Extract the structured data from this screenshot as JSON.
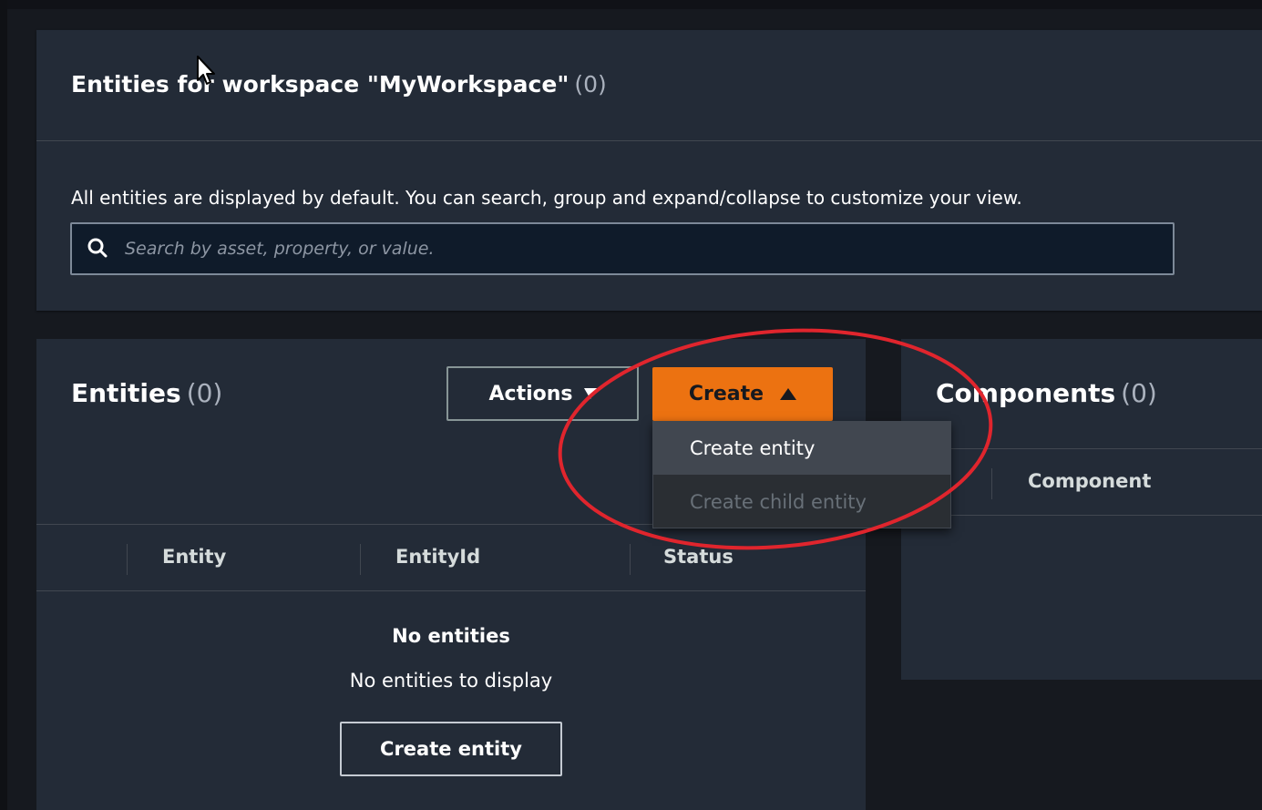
{
  "workspace_panel": {
    "title": "Entities for workspace \"MyWorkspace\"",
    "count": "(0)",
    "description": "All entities are displayed by default. You can search, group and expand/collapse to customize your view.",
    "search_placeholder": "Search by asset, property, or value."
  },
  "entities_panel": {
    "title": "Entities",
    "count": "(0)",
    "actions_label": "Actions",
    "create_label": "Create",
    "columns": [
      "Entity",
      "EntityId",
      "Status"
    ],
    "empty_title": "No entities",
    "empty_message": "No entities to display",
    "empty_create_label": "Create entity"
  },
  "create_menu": {
    "items": [
      {
        "label": "Create entity",
        "state": "highlighted"
      },
      {
        "label": "Create child entity",
        "state": "disabled"
      }
    ]
  },
  "components_panel": {
    "title": "Components",
    "count": "(0)",
    "columns": [
      "Component"
    ]
  },
  "colors": {
    "background": "#16191f",
    "panel": "#232b37",
    "primary_button": "#ec7211",
    "annotation": "#e0252d"
  },
  "icons": [
    "search-icon",
    "caret-down-icon",
    "caret-up-icon",
    "mouse-cursor-icon"
  ]
}
